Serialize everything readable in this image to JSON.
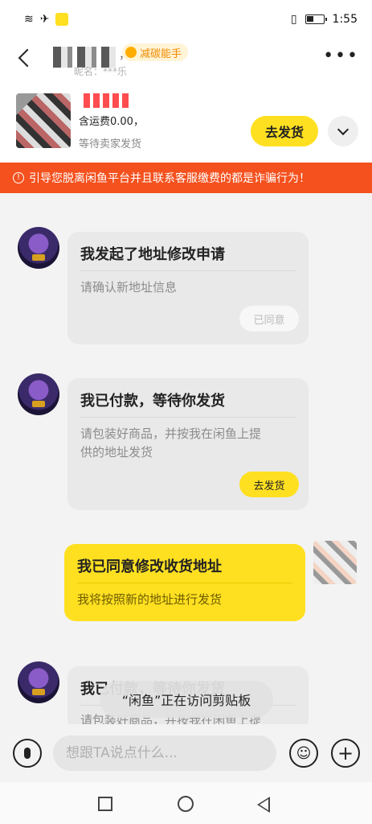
{
  "status_bar": {
    "time": "1:55",
    "wifi_icon": "wifi-icon",
    "airplane_icon": "airplane-icon",
    "vibrate_icon": "vibrate-icon",
    "battery_icon": "battery-icon"
  },
  "header": {
    "name_separator": "，",
    "eco_tag": "减碳能手",
    "subname": "昵名：***乐",
    "back_icon": "back-arrow-icon",
    "more_icon": "more-icon"
  },
  "order": {
    "shipping_fee": "含运费0.00，",
    "status": "等待卖家发货",
    "ship_button": "去发货"
  },
  "warning": {
    "text": "引导您脱离闲鱼平台并且联系客服缴费的都是诈骗行为！"
  },
  "messages": [
    {
      "side": "left",
      "title": "我发起了地址修改申请",
      "desc": "请确认新地址信息",
      "action": "已同意"
    },
    {
      "side": "left",
      "title": "我已付款，等待你发货",
      "desc_line1": "请包装好商品，并按我在闲鱼上提",
      "desc_line2": "供的地址发货",
      "action": "去发货"
    },
    {
      "side": "right",
      "title": "我已同意修改收货地址",
      "desc": "我将按照新的地址进行发货"
    },
    {
      "side": "left",
      "title": "我已付款，等待你发货",
      "desc": "请包装好商品，并按我在闲鱼上提"
    }
  ],
  "toast": "“闲鱼”正在访问剪贴板",
  "input": {
    "placeholder": "想跟TA说点什么..."
  },
  "colors": {
    "accent_yellow": "#ffe021",
    "warning_red": "#f4511e",
    "eco_orange": "#f08a00"
  }
}
